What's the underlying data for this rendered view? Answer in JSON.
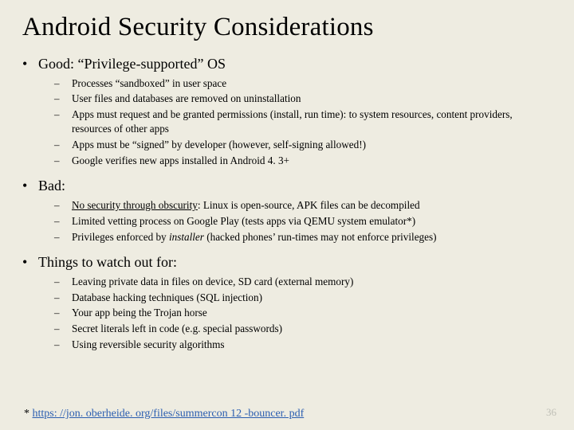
{
  "title": "Android Security Considerations",
  "sections": [
    {
      "heading": "Good: “Privilege-supported” OS",
      "items": [
        {
          "text": "Processes “sandboxed” in user space"
        },
        {
          "text": "User files and databases are removed on uninstallation"
        },
        {
          "text": "Apps must request and be granted permissions (install, run time): to system resources, content providers, resources of other apps"
        },
        {
          "text": "Apps must be “signed” by developer (however, self-signing allowed!)"
        },
        {
          "text": "Google verifies new apps installed in Android 4. 3+"
        }
      ]
    },
    {
      "heading": "Bad:",
      "items": [
        {
          "pre_u": "No security through obscurity",
          "post": ": Linux is open-source, APK files can be decompiled"
        },
        {
          "text": "Limited vetting process on Google Play (tests apps via QEMU system emulator*)"
        },
        {
          "pre": "Privileges enforced by ",
          "ital": "installer",
          "post": " (hacked phones’ run-times may not enforce privileges)"
        }
      ]
    },
    {
      "heading": "Things to watch out for:",
      "items": [
        {
          "text": "Leaving private data in files on device, SD card (external memory)"
        },
        {
          "text": "Database hacking techniques (SQL injection)"
        },
        {
          "text": "Your app being the Trojan horse"
        },
        {
          "text": "Secret literals left in code (e.g. special passwords)"
        },
        {
          "text": "Using reversible security algorithms"
        }
      ]
    }
  ],
  "footnote_prefix": "* ",
  "footnote_link": "https: //jon. oberheide. org/files/summercon 12 -bouncer. pdf",
  "page_number": "36",
  "bullet": "•",
  "dash": "–"
}
